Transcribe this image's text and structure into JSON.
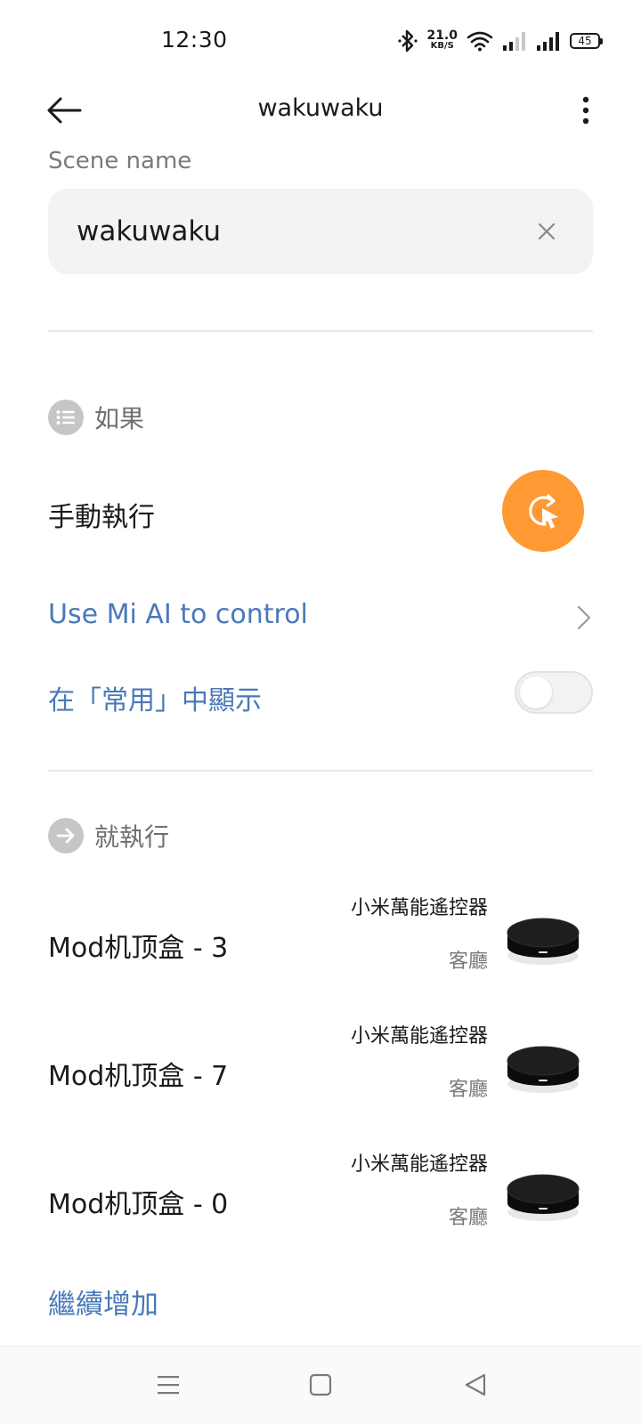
{
  "status_bar": {
    "time": "12:30",
    "net_speed_value": "21.0",
    "net_speed_unit": "KB/S",
    "battery": "45"
  },
  "header": {
    "title": "wakuwaku"
  },
  "scene": {
    "label": "Scene name",
    "value": "wakuwaku"
  },
  "if_section": {
    "title": "如果",
    "manual_label": "手動執行",
    "mi_ai_link": "Use Mi AI to control",
    "show_in_common": "在「常用」中顯示"
  },
  "then_section": {
    "title": "就執行",
    "actions": [
      {
        "name": "Mod机顶盒 - 3",
        "device": "小米萬能遙控器",
        "room": "客廳"
      },
      {
        "name": "Mod机顶盒 - 7",
        "device": "小米萬能遙控器",
        "room": "客廳"
      },
      {
        "name": "Mod机顶盒 - 0",
        "device": "小米萬能遙控器",
        "room": "客廳"
      }
    ],
    "add_more": "繼續增加"
  },
  "colors": {
    "accent_blue": "#4a79b8",
    "manual_orange": "#ff9933",
    "input_bg": "#f3f3f3"
  },
  "icons": {
    "back": "arrow-left-icon",
    "more": "more-vertical-icon",
    "clear": "close-icon",
    "if_section": "list-icon",
    "then_section": "arrow-right-icon",
    "manual": "tap-cursor-icon",
    "chevron": "chevron-right-icon",
    "nav_menu": "menu-icon",
    "nav_home": "home-square-icon",
    "nav_back": "back-triangle-icon"
  },
  "toggle": {
    "show_in_common": false
  }
}
